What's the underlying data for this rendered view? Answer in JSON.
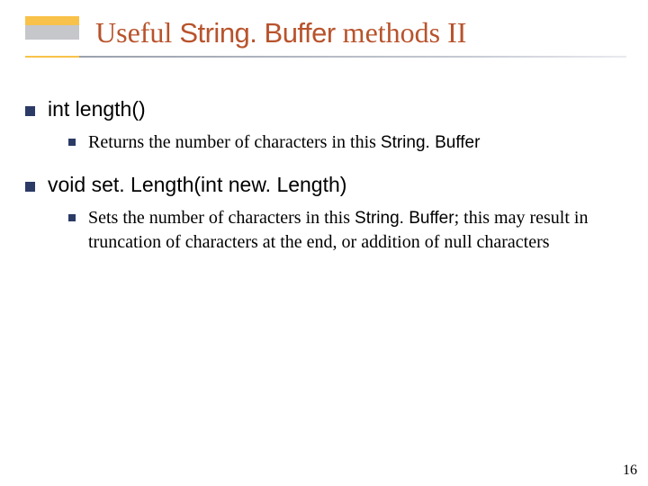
{
  "title": {
    "pre": "Useful ",
    "code": "String. Buffer",
    "post": " methods II"
  },
  "items": [
    {
      "method": "int length()",
      "desc": {
        "pre": "Returns the number of characters in this ",
        "code": "String. Buffer",
        "post": ""
      }
    },
    {
      "method": "void set. Length(int new. Length)",
      "desc": {
        "pre": "Sets the number of characters in this ",
        "code": "String. Buffer",
        "post": "; this may result in truncation of characters at the end, or addition of null characters"
      }
    }
  ],
  "pagenum": "16"
}
